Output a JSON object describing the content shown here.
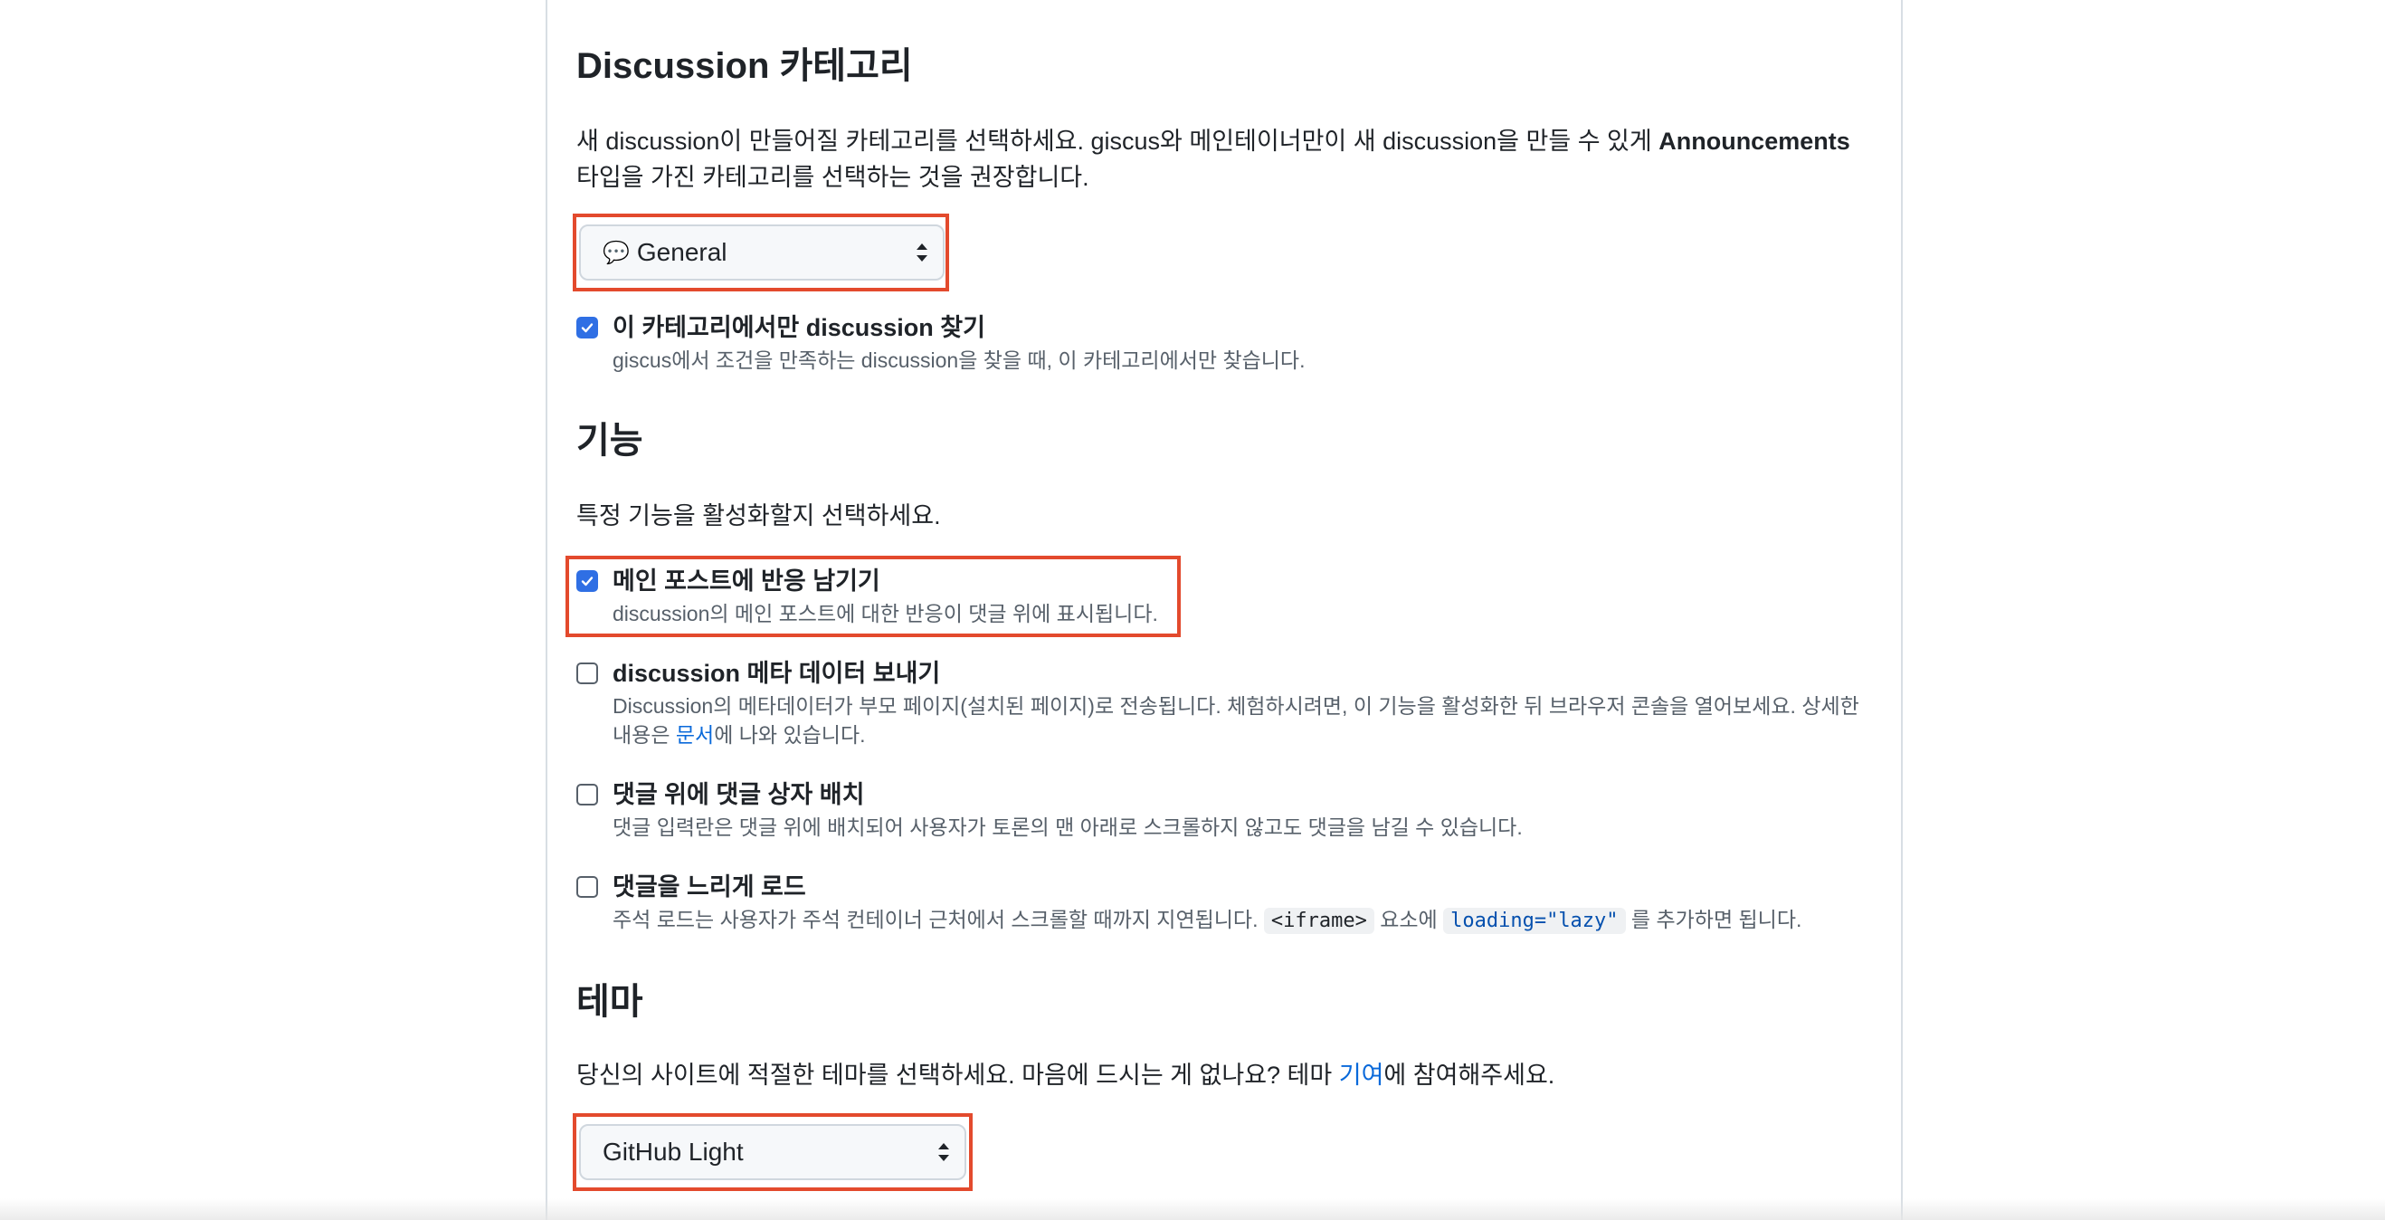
{
  "category_section": {
    "heading": "Discussion 카테고리",
    "desc_before": "새 discussion이 만들어질 카테고리를 선택하세요. giscus와 메인테이너만이 새 discussion을 만들 수 있게 ",
    "desc_bold": "Announcements",
    "desc_line2": "타입을 가진 카테고리를 선택하는 것을 권장합니다.",
    "select": {
      "emoji": "💬",
      "value": "General"
    },
    "strict_option": {
      "checked": true,
      "title": "이 카테고리에서만 discussion 찾기",
      "desc": "giscus에서 조건을 만족하는 discussion을 찾을 때, 이 카테고리에서만 찾습니다."
    }
  },
  "features_section": {
    "heading": "기능",
    "desc": "특정 기능을 활성화할지 선택하세요.",
    "options": [
      {
        "checked": true,
        "title": "메인 포스트에 반응 남기기",
        "desc": "discussion의 메인 포스트에 대한 반응이 댓글 위에 표시됩니다."
      },
      {
        "checked": false,
        "title": "discussion 메타 데이터 보내기",
        "desc_line1": "Discussion의 메타데이터가 부모 페이지(설치된 페이지)로 전송됩니다. 체험하시려면, 이 기능을 활성화한 뒤 브라우저 콘솔을 열어보세요. 상세한",
        "desc_line2_before": "내용은 ",
        "desc_link": "문서",
        "desc_line2_after": "에 나와 있습니다."
      },
      {
        "checked": false,
        "title": "댓글 위에 댓글 상자 배치",
        "desc": "댓글 입력란은 댓글 위에 배치되어 사용자가 토론의 맨 아래로 스크롤하지 않고도 댓글을 남길 수 있습니다."
      },
      {
        "checked": false,
        "title": "댓글을 느리게 로드",
        "desc_before": "주석 로드는 사용자가 주석 컨테이너 근처에서 스크롤할 때까지 지연됩니다. ",
        "code1": "<iframe>",
        "desc_mid": " 요소에 ",
        "code2": "loading=\"lazy\"",
        "desc_after": " 를 추가하면 됩니다."
      }
    ]
  },
  "theme_section": {
    "heading": "테마",
    "desc_before": "당신의 사이트에 적절한 테마를 선택하세요. 마음에 드시는 게 없나요? 테마 ",
    "desc_link": "기여",
    "desc_after": "에 참여해주세요.",
    "select": {
      "value": "GitHub Light"
    }
  },
  "colors": {
    "highlight": "#e34a2d",
    "checkbox_checked": "#2f6fe4",
    "link": "#0969da"
  }
}
